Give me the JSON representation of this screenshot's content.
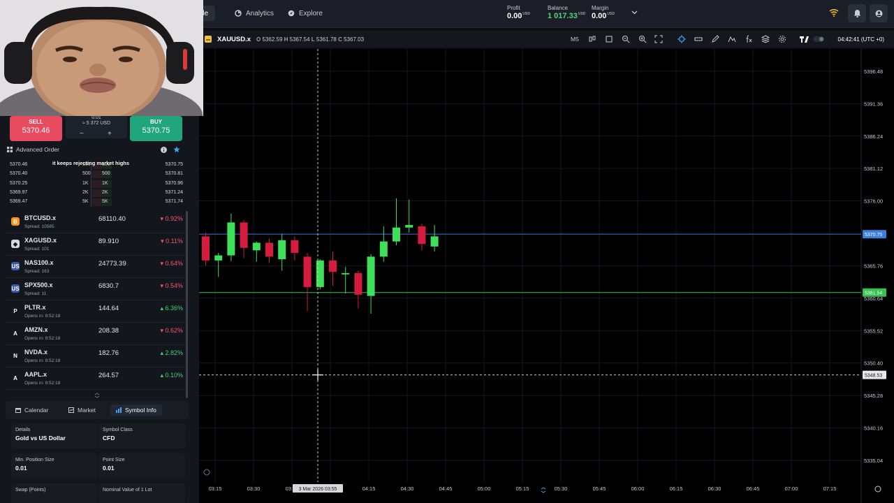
{
  "topbar": {
    "tabs": [
      {
        "label": "rade",
        "active": true
      },
      {
        "label": "Analytics",
        "active": false
      },
      {
        "label": "Explore",
        "active": false
      }
    ],
    "profit": {
      "label": "Profit",
      "value": "0.00",
      "unit": "USD"
    },
    "balance": {
      "label": "Balance",
      "value": "1 017.33",
      "unit": "USD"
    },
    "margin": {
      "label": "Margin",
      "value": "0.00",
      "unit": "USD"
    }
  },
  "order": {
    "sell_label": "SELL",
    "sell_price": "5370.46",
    "buy_label": "BUY",
    "buy_price": "5370.75",
    "qty": "0.01",
    "qty_usd": "≈ 5 372 USD",
    "minus": "−",
    "plus": "+",
    "advanced_label": "Advanced Order"
  },
  "depth": [
    {
      "bid_price": "5370.46",
      "bid_size": "100",
      "ask_size": "100",
      "ask_price": "5370.75"
    },
    {
      "bid_price": "5370.40",
      "bid_size": "500",
      "ask_size": "500",
      "ask_price": "5370.81"
    },
    {
      "bid_price": "5370.25",
      "bid_size": "1K",
      "ask_size": "1K",
      "ask_price": "5370.96"
    },
    {
      "bid_price": "5369.97",
      "bid_size": "2K",
      "ask_size": "2K",
      "ask_price": "5371.24"
    },
    {
      "bid_price": "5369.47",
      "bid_size": "5K",
      "ask_size": "5K",
      "ask_price": "5371.74"
    }
  ],
  "caption": "it keeps rejecting market highs",
  "watchlist": [
    {
      "symbol": "BTCUSD.x",
      "sub": "Spread: 10585",
      "price": "68110.40",
      "change": "0.92%",
      "dir": "neg",
      "icon": "B",
      "icon_bg": "#f7931a"
    },
    {
      "symbol": "XAGUSD.x",
      "sub": "Spread: 101",
      "price": "89.910",
      "change": "0.11%",
      "dir": "neg",
      "icon": "◆",
      "icon_bg": "#d6d8dc"
    },
    {
      "symbol": "NAS100.x",
      "sub": "Spread: 163",
      "price": "24773.39",
      "change": "0.64%",
      "dir": "neg",
      "icon": "US",
      "icon_bg": "#3c5aa6"
    },
    {
      "symbol": "SPX500.x",
      "sub": "Spread: 11",
      "price": "6830.7",
      "change": "0.54%",
      "dir": "neg",
      "icon": "US",
      "icon_bg": "#3c5aa6"
    },
    {
      "symbol": "PLTR.x",
      "sub": "Opens in: 9:52:18",
      "price": "144.64",
      "change": "6.36%",
      "dir": "pos",
      "icon": "P",
      "icon_bg": "#13161c"
    },
    {
      "symbol": "AMZN.x",
      "sub": "Opens in: 9:52:18",
      "price": "208.38",
      "change": "0.62%",
      "dir": "neg",
      "icon": "A",
      "icon_bg": "#13161c"
    },
    {
      "symbol": "NVDA.x",
      "sub": "Opens in: 9:52:18",
      "price": "182.76",
      "change": "2.82%",
      "dir": "pos",
      "icon": "N",
      "icon_bg": "#13161c"
    },
    {
      "symbol": "AAPL.x",
      "sub": "Opens in: 9:52:18",
      "price": "264.57",
      "change": "0.10%",
      "dir": "pos",
      "icon": "A",
      "icon_bg": "#13161c"
    }
  ],
  "bottom_tabs": [
    {
      "label": "Calendar",
      "active": false
    },
    {
      "label": "Market",
      "active": false
    },
    {
      "label": "Symbol Info",
      "active": true
    }
  ],
  "symbol_info": [
    {
      "label": "Details",
      "value": "Gold vs US Dollar"
    },
    {
      "label": "Symbol Class",
      "value": "CFD"
    },
    {
      "label": "Min. Position Size",
      "value": "0.01"
    },
    {
      "label": "Point Size",
      "value": "0.01"
    },
    {
      "label": "Swap (Points)",
      "value": ""
    },
    {
      "label": "Nominal Value of 1 Lot",
      "value": ""
    }
  ],
  "chart_header": {
    "symbol": "XAUUSD.x",
    "open_label": "O",
    "open": "5362.59",
    "high_label": "H",
    "high": "5367.54",
    "low_label": "L",
    "low": "5361.78",
    "close_label": "C",
    "close": "5367.03",
    "timeframe": "M5",
    "clock": "04:42:41 (UTC +0)"
  },
  "chart_data": {
    "type": "candlestick",
    "y_ticks": [
      "5396.48",
      "5391.36",
      "5386.24",
      "5381.12",
      "5376.00",
      "5370.88",
      "5365.76",
      "5360.64",
      "5355.52",
      "5350.40",
      "5345.28",
      "5340.16",
      "5335.04"
    ],
    "ylim": [
      5332.5,
      5400.0
    ],
    "x_ticks": [
      "03:15",
      "03:30",
      "03:45",
      "04:00",
      "04:15",
      "04:30",
      "04:45",
      "05:00",
      "05:15",
      "05:30",
      "05:45",
      "06:00",
      "06:15",
      "06:30",
      "06:45",
      "07:00",
      "07:15"
    ],
    "crosshair_time": "3 Mar 2026 03:55",
    "crosshair_price": "5348.53",
    "ask_line": "5370.75",
    "bid_line": "5361.54",
    "candles": [
      {
        "o": 5370.4,
        "h": 5371.0,
        "l": 5365.8,
        "c": 5366.6
      },
      {
        "o": 5366.6,
        "h": 5367.8,
        "l": 5364.0,
        "c": 5367.4
      },
      {
        "o": 5367.4,
        "h": 5374.0,
        "l": 5366.5,
        "c": 5372.6
      },
      {
        "o": 5372.6,
        "h": 5373.0,
        "l": 5367.0,
        "c": 5368.6
      },
      {
        "o": 5368.2,
        "h": 5369.6,
        "l": 5366.4,
        "c": 5369.4
      },
      {
        "o": 5369.4,
        "h": 5370.0,
        "l": 5366.2,
        "c": 5367.2
      },
      {
        "o": 5366.8,
        "h": 5370.8,
        "l": 5365.0,
        "c": 5369.8
      },
      {
        "o": 5369.8,
        "h": 5370.4,
        "l": 5366.6,
        "c": 5367.8
      },
      {
        "o": 5367.2,
        "h": 5367.8,
        "l": 5358.6,
        "c": 5362.4
      },
      {
        "o": 5362.4,
        "h": 5366.8,
        "l": 5362.0,
        "c": 5366.6
      },
      {
        "o": 5366.6,
        "h": 5368.0,
        "l": 5362.6,
        "c": 5364.8
      },
      {
        "o": 5364.4,
        "h": 5365.6,
        "l": 5361.4,
        "c": 5364.6
      },
      {
        "o": 5364.6,
        "h": 5365.0,
        "l": 5359.0,
        "c": 5361.2
      },
      {
        "o": 5361.0,
        "h": 5367.6,
        "l": 5358.2,
        "c": 5367.2
      },
      {
        "o": 5367.2,
        "h": 5372.0,
        "l": 5366.4,
        "c": 5369.6
      },
      {
        "o": 5369.6,
        "h": 5376.4,
        "l": 5369.0,
        "c": 5371.8
      },
      {
        "o": 5371.8,
        "h": 5376.2,
        "l": 5371.0,
        "c": 5372.2
      },
      {
        "o": 5372.0,
        "h": 5372.4,
        "l": 5368.2,
        "c": 5369.2
      },
      {
        "o": 5368.8,
        "h": 5372.2,
        "l": 5368.0,
        "c": 5370.4
      }
    ]
  }
}
